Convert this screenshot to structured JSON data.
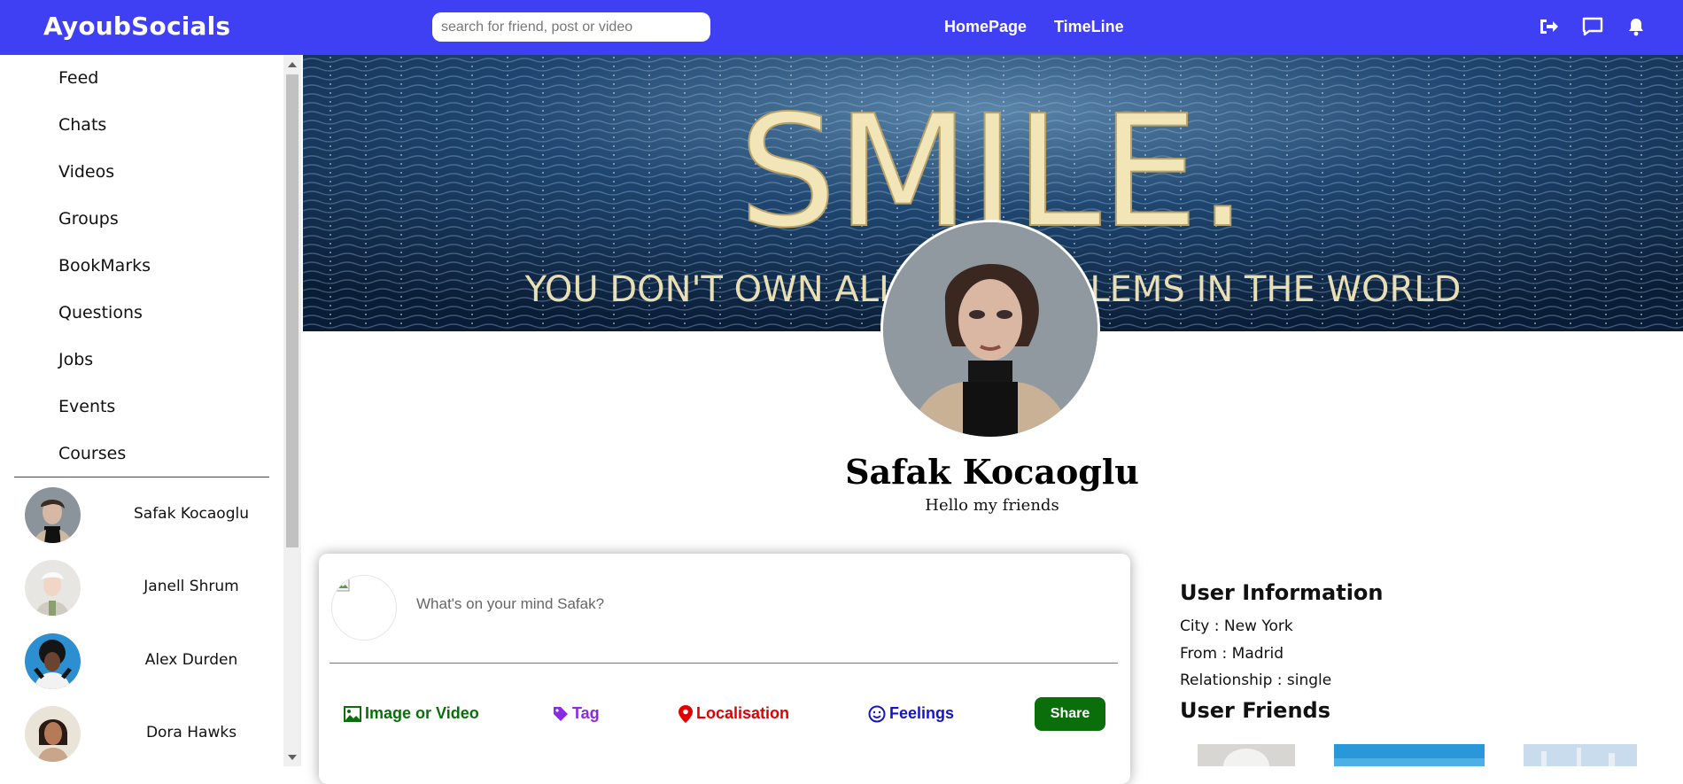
{
  "app": {
    "brand": "AyoubSocials"
  },
  "search": {
    "placeholder": "search for friend, post or video"
  },
  "nav": {
    "home": "HomePage",
    "timeline": "TimeLine"
  },
  "icons": [
    "logout-icon",
    "chat-icon",
    "bell-icon"
  ],
  "sidebar": {
    "menu": [
      "Feed",
      "Chats",
      "Videos",
      "Groups",
      "BookMarks",
      "Questions",
      "Jobs",
      "Events",
      "Courses"
    ],
    "friends": [
      "Safak Kocaoglu",
      "Janell Shrum",
      "Alex Durden",
      "Dora Hawks"
    ]
  },
  "cover": {
    "headline": "SMILE.",
    "subline": "YOU DON'T OWN ALL THE PROBLEMS IN THE WORLD"
  },
  "profile": {
    "name": "Safak Kocaoglu",
    "description": "Hello my friends"
  },
  "share": {
    "placeholder": "What's on your mind Safak?",
    "options": {
      "media": "Image or Video",
      "tag": "Tag",
      "location": "Localisation",
      "feelings": "Feelings"
    },
    "button": "Share"
  },
  "user_info": {
    "title": "User Information",
    "city_label": "City :",
    "city": "New York",
    "from_label": "From :",
    "from": "Madrid",
    "relationship_label": "Relationship :",
    "relationship": "single",
    "friends_title": "User Friends"
  },
  "colors": {
    "topbar": "#3f3ff3",
    "media": "#0a6f0a",
    "tag": "#8a2be2",
    "location": "#e00000",
    "feelings": "#1515c8",
    "share_button": "#0a6f0a"
  }
}
